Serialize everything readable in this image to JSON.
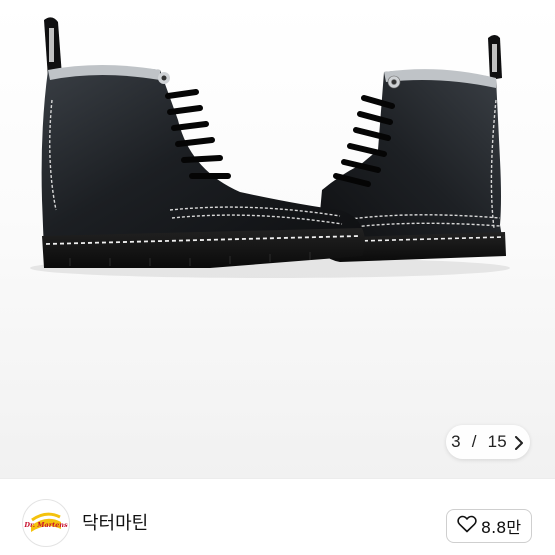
{
  "gallery": {
    "current_index": "3",
    "separator": " / ",
    "total_count": "15",
    "next_icon": "chevron-right-icon",
    "product_image": "black-leather-8-eye-boots-with-white-contrast-stitching"
  },
  "seller": {
    "brand_name": "닥터마틴",
    "logo": "dr-martens-logo",
    "logo_text": "Dr. Martens"
  },
  "actions": {
    "like_icon": "heart-outline-icon",
    "like_count": "8.8만"
  },
  "colors": {
    "logo_yellow": "#f4c20d",
    "logo_red": "#c8102e",
    "boot_black": "#1a1a1a",
    "stitch_white": "#e8e8e8"
  }
}
